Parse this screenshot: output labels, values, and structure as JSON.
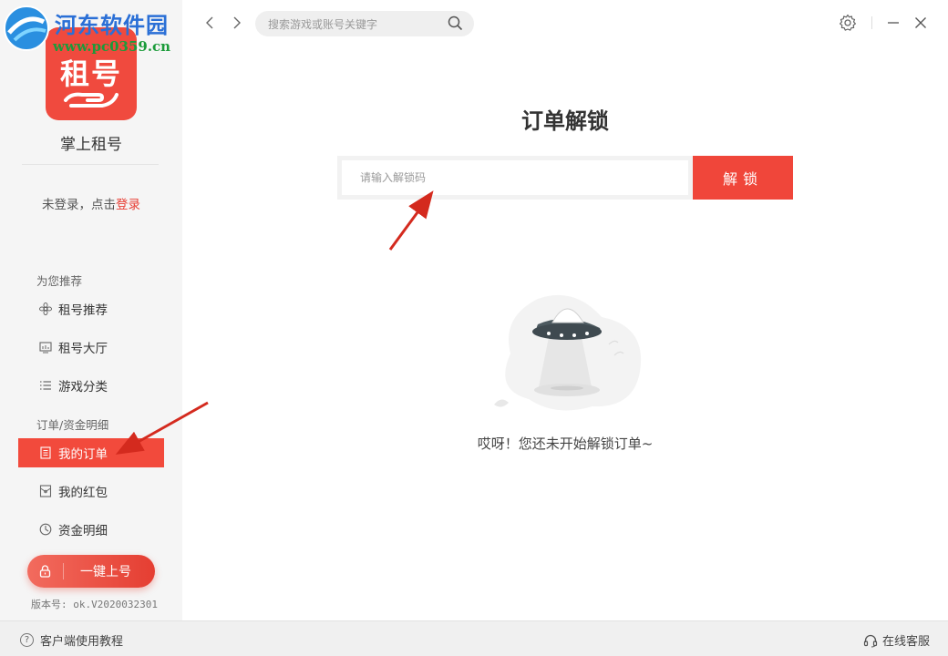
{
  "watermark": {
    "title": "河东软件园",
    "url": "www.pc0359.cn"
  },
  "app": {
    "logo_text": "租号",
    "name": "掌上租号"
  },
  "login": {
    "prefix": "未登录，点击",
    "link": "登录"
  },
  "sidebar": {
    "section_recommend": "为您推荐",
    "section_orders": "订单/资金明细",
    "items": [
      {
        "label": "租号推荐",
        "icon": "flower-icon"
      },
      {
        "label": "租号大厅",
        "icon": "monitor-icon"
      },
      {
        "label": "游戏分类",
        "icon": "list-icon"
      },
      {
        "label": "我的订单",
        "icon": "document-icon",
        "active": true
      },
      {
        "label": "我的红包",
        "icon": "envelope-icon"
      },
      {
        "label": "资金明细",
        "icon": "clock-icon"
      }
    ],
    "oneclick_label": "一键上号",
    "version": "版本号: ok.V2020032301"
  },
  "topbar": {
    "search_placeholder": "搜索游戏或账号关键字"
  },
  "main": {
    "title": "订单解锁",
    "input_placeholder": "请输入解锁码",
    "unlock_button": "解锁",
    "empty_text": "哎呀！您还未开始解锁订单~"
  },
  "bottombar": {
    "tutorial": "客户端使用教程",
    "support": "在线客服"
  },
  "colors": {
    "accent": "#f0463a",
    "sidebar_bg": "#f5f5f5",
    "watermark_blue": "#2a6fd6",
    "watermark_green": "#1b9b3a"
  }
}
